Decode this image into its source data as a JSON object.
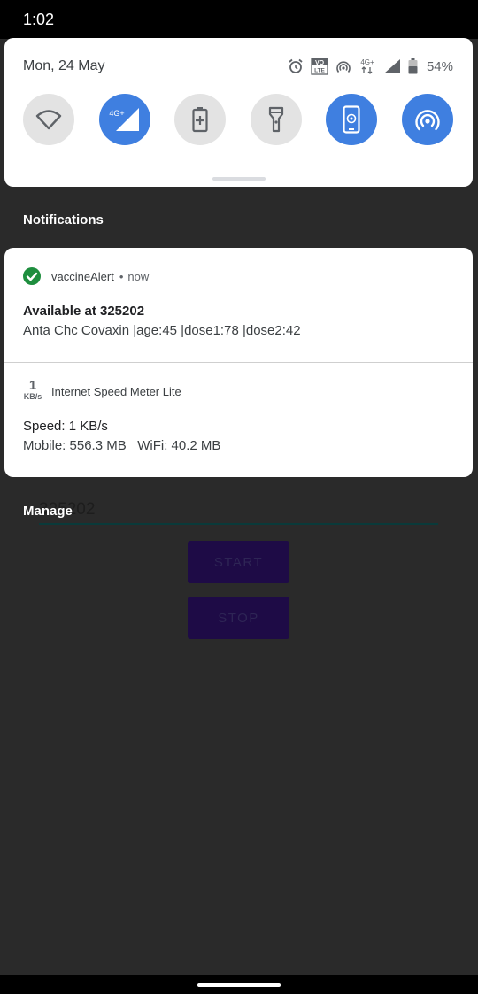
{
  "status_bar": {
    "time": "1:02"
  },
  "quick_settings": {
    "date": "Mon, 24 May",
    "status_icons": {
      "alarm": "alarm-icon",
      "volte": {
        "top": "VO",
        "bottom": "LTE"
      },
      "hotspot": "hotspot-icon",
      "network": "4G+",
      "signal": "signal-icon",
      "battery": "54%"
    },
    "tiles": [
      {
        "name": "wifi",
        "icon": "wifi-icon",
        "on": false
      },
      {
        "name": "mobile-data",
        "icon": "mobile-data-icon",
        "label": "4G+",
        "on": true
      },
      {
        "name": "battery-saver",
        "icon": "battery-saver-icon",
        "on": false
      },
      {
        "name": "flashlight",
        "icon": "flashlight-icon",
        "on": false
      },
      {
        "name": "auto-rotate",
        "icon": "auto-rotate-icon",
        "on": true
      },
      {
        "name": "hotspot",
        "icon": "hotspot-icon",
        "on": true
      }
    ]
  },
  "notifications": {
    "header": "Notifications",
    "items": [
      {
        "app": "vaccineAlert",
        "separator": "•",
        "time": "now",
        "title": "Available at 325202",
        "text": "Anta Chc Covaxin |age:45 |dose1:78 |dose2:42"
      },
      {
        "app": "Internet Speed Meter Lite",
        "icon_number": "1",
        "icon_unit": "KB/s",
        "title": "Speed: 1 KB/s",
        "text": "Mobile: 556.3 MB   WiFi: 40.2 MB"
      }
    ],
    "manage_label": "Manage"
  },
  "app": {
    "pincode_value": "325202",
    "start_label": "START",
    "stop_label": "STOP"
  },
  "colors": {
    "accent_blue": "#3f7fe0",
    "check_green": "#1e8e3e",
    "dim_background": "#2a2a2a"
  }
}
